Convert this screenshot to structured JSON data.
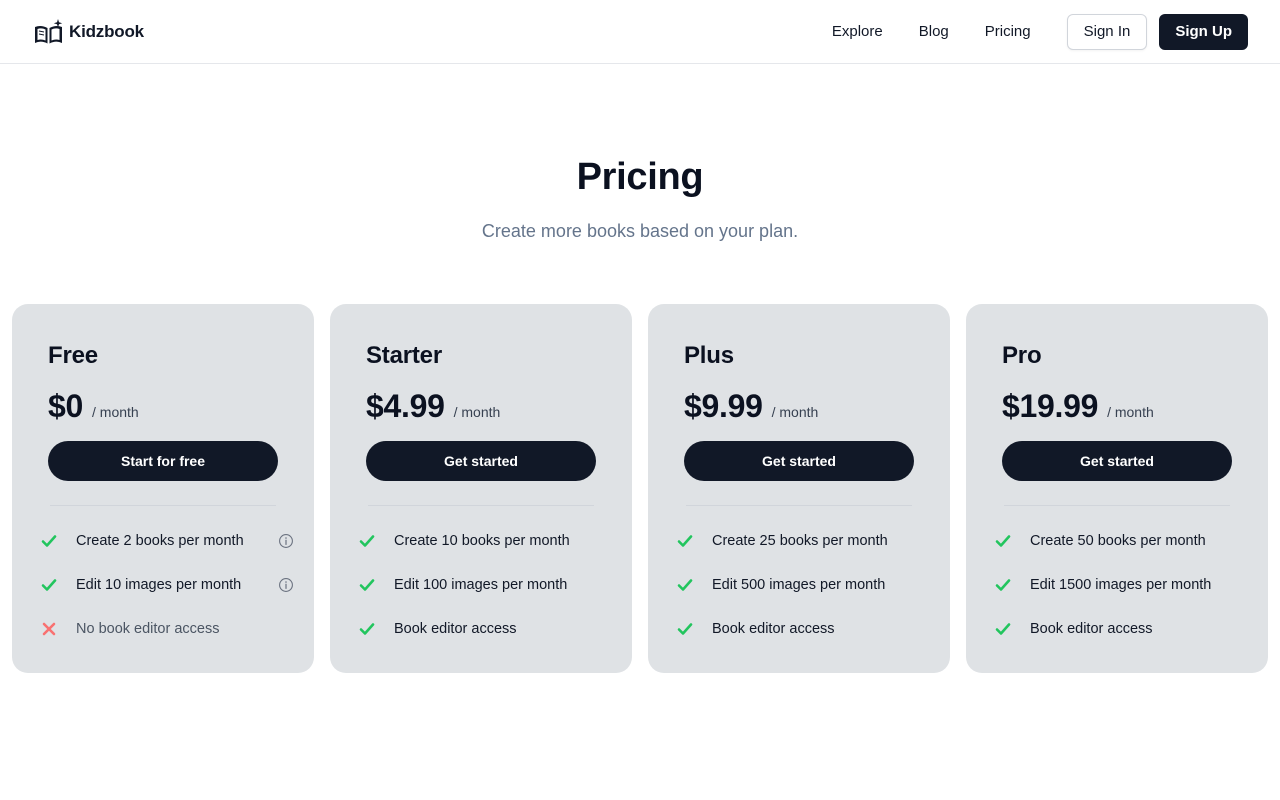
{
  "header": {
    "brand": "Kidzbook",
    "nav": [
      "Explore",
      "Blog",
      "Pricing"
    ],
    "sign_in": "Sign In",
    "sign_up": "Sign Up"
  },
  "hero": {
    "title": "Pricing",
    "subtitle": "Create more books based on your plan."
  },
  "colors": {
    "check": "#22c55e",
    "cross": "#f87171",
    "primary": "#111827",
    "card": "#dfe2e5"
  },
  "plans": [
    {
      "name": "Free",
      "price": "$0",
      "period": "/ month",
      "cta": "Start for free",
      "features": [
        {
          "text": "Create 2 books per month",
          "icon": "check-icon",
          "info": true
        },
        {
          "text": "Edit 10 images per month",
          "icon": "check-icon",
          "info": true
        },
        {
          "text": "No book editor access",
          "icon": "cross-icon",
          "info": false
        }
      ]
    },
    {
      "name": "Starter",
      "price": "$4.99",
      "period": "/ month",
      "cta": "Get started",
      "features": [
        {
          "text": "Create 10 books per month",
          "icon": "check-icon",
          "info": false
        },
        {
          "text": "Edit 100 images per month",
          "icon": "check-icon",
          "info": false
        },
        {
          "text": "Book editor access",
          "icon": "check-icon",
          "info": false
        }
      ]
    },
    {
      "name": "Plus",
      "price": "$9.99",
      "period": "/ month",
      "cta": "Get started",
      "features": [
        {
          "text": "Create 25 books per month",
          "icon": "check-icon",
          "info": false
        },
        {
          "text": "Edit 500 images per month",
          "icon": "check-icon",
          "info": false
        },
        {
          "text": "Book editor access",
          "icon": "check-icon",
          "info": false
        }
      ]
    },
    {
      "name": "Pro",
      "price": "$19.99",
      "period": "/ month",
      "cta": "Get started",
      "features": [
        {
          "text": "Create 50 books per month",
          "icon": "check-icon",
          "info": false
        },
        {
          "text": "Edit 1500 images per month",
          "icon": "check-icon",
          "info": false
        },
        {
          "text": "Book editor access",
          "icon": "check-icon",
          "info": false
        }
      ]
    }
  ]
}
